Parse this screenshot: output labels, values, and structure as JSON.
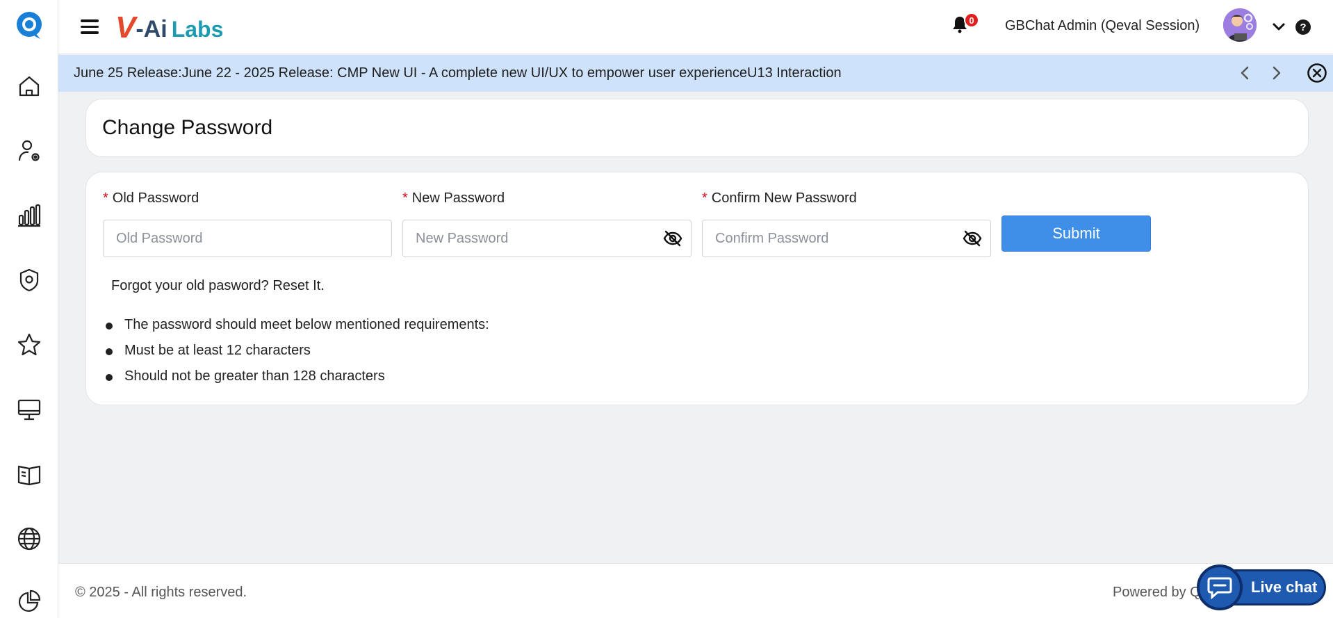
{
  "brand": {
    "v": "V",
    "ai": "-Ai",
    "labs": "Labs"
  },
  "sidebar": {
    "items": [
      {
        "name": "home"
      },
      {
        "name": "user-settings"
      },
      {
        "name": "analytics"
      },
      {
        "name": "security"
      },
      {
        "name": "favorites"
      },
      {
        "name": "monitor"
      },
      {
        "name": "knowledge-book"
      },
      {
        "name": "globe"
      },
      {
        "name": "reports"
      }
    ]
  },
  "header": {
    "notifications_count": "0",
    "user_name": "GBChat Admin (Qeval Session)",
    "help_label": "?"
  },
  "banner": {
    "text": "June 25 Release:June 22 - 2025 Release: CMP New UI - A complete new UI/UX to empower user experienceU13 Interaction"
  },
  "page": {
    "title": "Change Password"
  },
  "form": {
    "old_password": {
      "label": "Old Password",
      "required_mark": "*",
      "placeholder": "Old Password",
      "value": ""
    },
    "new_password": {
      "label": "New Password",
      "required_mark": "*",
      "placeholder": "New Password",
      "value": ""
    },
    "confirm_password": {
      "label": "Confirm New Password",
      "required_mark": "*",
      "placeholder": "Confirm Password",
      "value": ""
    },
    "submit_label": "Submit",
    "forgot_text": "Forgot your old pasword? Reset It.",
    "requirements": [
      "The password should meet below mentioned requirements:",
      "Must be at least 12 characters",
      "Should not be greater than 128 characters"
    ]
  },
  "footer": {
    "copyright": "© 2025 - All rights reserved.",
    "powered_by": "Powered by Q"
  },
  "live_chat": {
    "label": "Live chat"
  },
  "colors": {
    "accent": "#3f8fe8",
    "banner_bg": "#cfe2fb",
    "required": "#d0021b",
    "badge": "#e02020"
  }
}
